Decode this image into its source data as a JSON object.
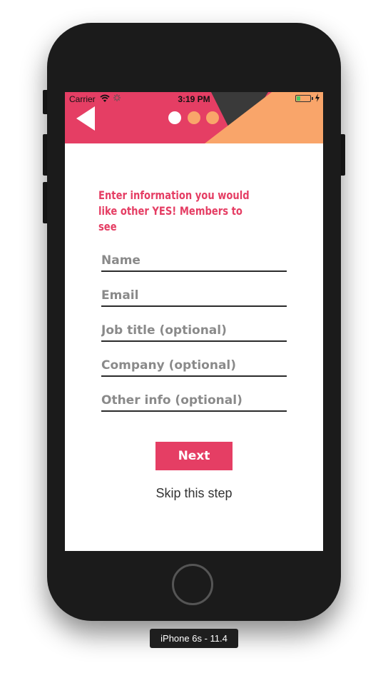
{
  "status_bar": {
    "carrier": "Carrier",
    "time": "3:19 PM"
  },
  "header": {
    "back_icon": "back-arrow-icon",
    "progress_steps": 3,
    "current_step": 1,
    "colors": {
      "primary": "#e53e64",
      "accent": "#f9a56a",
      "dark": "#3a3a3a"
    }
  },
  "form": {
    "intro_text": "Enter information you would like other YES! Members to see",
    "fields": {
      "name": {
        "placeholder": "Name",
        "value": ""
      },
      "email": {
        "placeholder": "Email",
        "value": ""
      },
      "job_title": {
        "placeholder": "Job title (optional)",
        "value": ""
      },
      "company": {
        "placeholder": "Company (optional)",
        "value": ""
      },
      "other_info": {
        "placeholder": "Other info (optional)",
        "value": ""
      }
    },
    "next_label": "Next",
    "skip_label": "Skip this step"
  },
  "simulator": {
    "device_label": "iPhone 6s - 11.4"
  }
}
